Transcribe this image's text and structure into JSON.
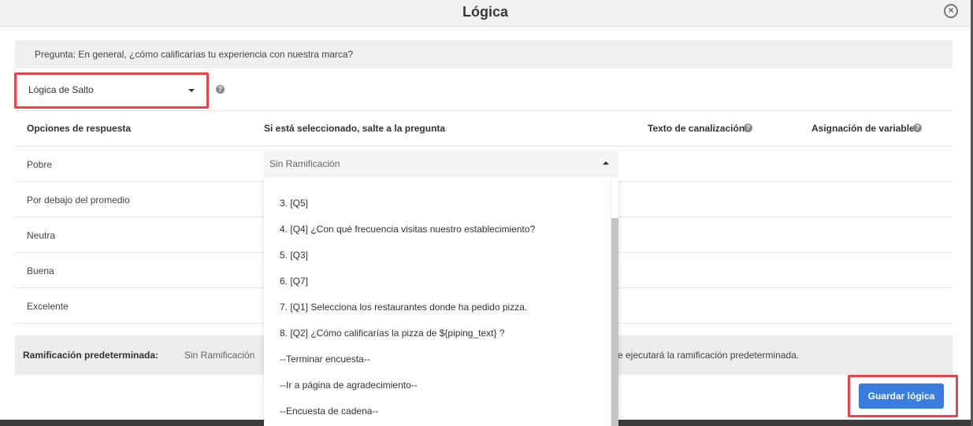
{
  "dialog": {
    "title": "Lógica",
    "close_symbol": "×",
    "question": "Pregunta: En general, ¿cómo calificarías tu experiencia con nuestra marca?"
  },
  "logic_type": {
    "selected": "Lógica de Salto"
  },
  "help_symbol": "?",
  "columns": {
    "options": "Opciones de respuesta",
    "skip_to": "Si está seleccionado, salte a la pregunta",
    "piping_text": "Texto de canalización",
    "variable": "Asignación de variable"
  },
  "rows": [
    {
      "label": "Pobre",
      "branch": "Sin Ramificación"
    },
    {
      "label": "Por debajo del promedio"
    },
    {
      "label": "Neutra"
    },
    {
      "label": "Buena"
    },
    {
      "label": "Excelente"
    }
  ],
  "dropdown": {
    "items": [
      "3. [Q5]",
      "4. [Q4] ¿Con qué frecuencia visitas nuestro establecimiento?",
      "5. [Q3]",
      "6. [Q7]",
      "7. [Q1] Selecciona los restaurantes donde ha pedido pizza.",
      "8. [Q2]  ¿Cómo calificarías la pizza de ${piping_text}  ?",
      "--Terminar encuesta--",
      "--Ir a página de agradecimiento--",
      "--Encuesta de cadena--"
    ]
  },
  "default_branch": {
    "label": "Ramificación predeterminada:",
    "value": "Sin Ramificación",
    "note": "e ejecutará la ramificación predeterminada."
  },
  "save_button": "Guardar lógica",
  "colors": {
    "accent": "#3b7ddd",
    "highlight": "#e8454a"
  }
}
